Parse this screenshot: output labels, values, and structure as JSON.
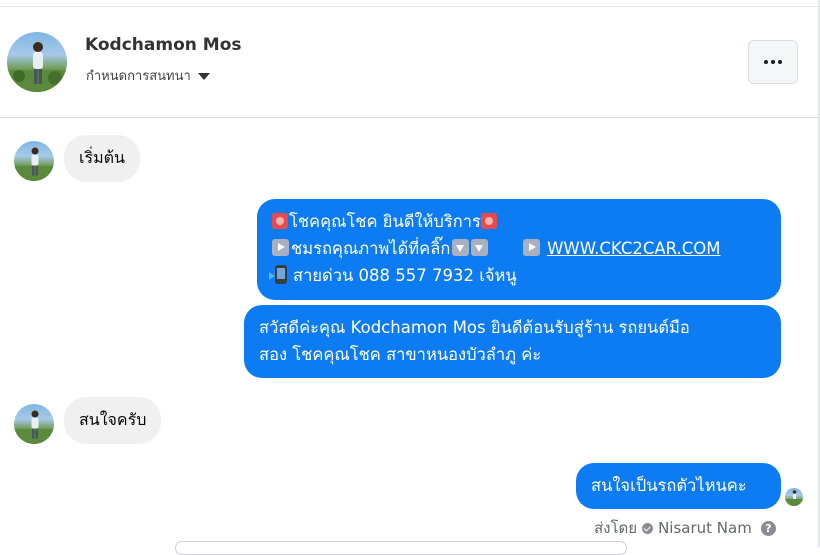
{
  "header": {
    "contact_name": "Kodchamon Mos",
    "customize_label": "กำหนดการสนทนา"
  },
  "messages": [
    {
      "direction": "incoming",
      "text": "เริ่มต้น"
    },
    {
      "direction": "outgoing",
      "lines": [
        {
          "text": "โชคคุณโชค ยินดีให้บริการ"
        },
        {
          "text": "ชมรถคุณภาพได้ที่คลิ๊ก",
          "link": "WWW.CKC2CAR.COM"
        },
        {
          "text": "สายด่วน 088 557 7932 เจ้หนู"
        }
      ]
    },
    {
      "direction": "outgoing",
      "lines": [
        "สวัสดีค่ะคุณ Kodchamon Mos ยินดีต้อนรับสู่ร้าน รถยนต์มือ",
        "สอง โชคคุณโชค สาขาหนองบัวลำภู ค่ะ"
      ]
    },
    {
      "direction": "incoming",
      "text": "สนใจครับ"
    },
    {
      "direction": "outgoing",
      "text": "สนใจเป็นรถตัวไหนคะ"
    }
  ],
  "sent_by": {
    "label": "ส่งโดย",
    "name": "Nisarut Nam"
  },
  "colors": {
    "outgoing_bubble": "#0d7bf2",
    "incoming_bubble": "#f0f0f0"
  },
  "icons": [
    "more-icon",
    "chevron-down-icon",
    "verified-check-icon",
    "help-icon"
  ]
}
